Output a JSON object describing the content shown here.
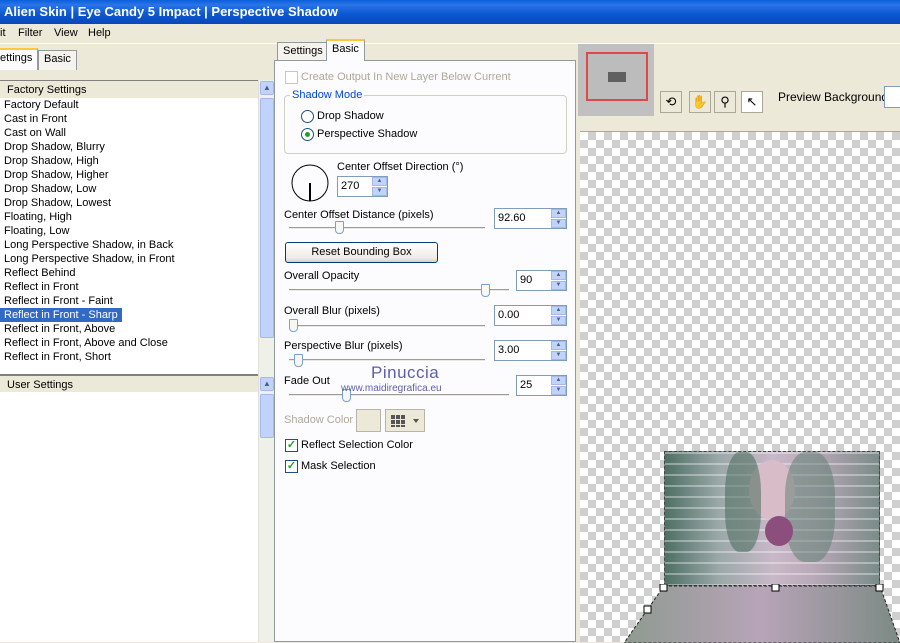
{
  "window": {
    "title": "Alien Skin  |  Eye Candy 5 Impact  |  Perspective Shadow"
  },
  "menu": {
    "items": [
      "it",
      "Filter",
      "View",
      "Help"
    ]
  },
  "left": {
    "tabs": [
      "ettings",
      "Basic"
    ],
    "factory_header": "Factory Settings",
    "presets": [
      "Factory Default",
      "Cast in Front",
      "Cast on Wall",
      "Drop Shadow, Blurry",
      "Drop Shadow, High",
      "Drop Shadow, Higher",
      "Drop Shadow, Low",
      "Drop Shadow, Lowest",
      "Floating, High",
      "Floating, Low",
      "Long Perspective Shadow, in Back",
      "Long Perspective Shadow, in Front",
      "Reflect Behind",
      "Reflect in Front",
      "Reflect in Front - Faint",
      "Reflect in Front - Sharp",
      "Reflect in Front, Above",
      "Reflect in Front, Above and Close",
      "Reflect in Front, Short"
    ],
    "selected_preset": "Reflect in Front - Sharp",
    "user_header": "User Settings"
  },
  "middle": {
    "tabs": [
      "Settings",
      "Basic"
    ],
    "create_output_label": "Create Output In New Layer Below Current",
    "shadow_mode": {
      "title": "Shadow Mode",
      "options": [
        "Drop Shadow",
        "Perspective Shadow"
      ],
      "selected": "Perspective Shadow"
    },
    "center_offset_direction": {
      "label": "Center Offset Direction (°)",
      "value": "270"
    },
    "center_offset_distance": {
      "label": "Center Offset Distance (pixels)",
      "value": "92.60",
      "position": 0.2
    },
    "reset_button": "Reset Bounding Box",
    "overall_opacity": {
      "label": "Overall Opacity",
      "value": "90",
      "position": 0.9
    },
    "overall_blur": {
      "label": "Overall Blur (pixels)",
      "value": "0.00",
      "position": 0.0
    },
    "perspective_blur": {
      "label": "Perspective Blur (pixels)",
      "value": "3.00",
      "position": 0.03
    },
    "fade_out": {
      "label": "Fade Out",
      "value": "25",
      "position": 0.25
    },
    "shadow_color_label": "Shadow Color",
    "shadow_color": "#ece9d8",
    "reflect_selection_color": {
      "label": "Reflect Selection Color",
      "checked": true
    },
    "mask_selection": {
      "label": "Mask Selection",
      "checked": true
    },
    "watermark": {
      "name": "Pinuccia",
      "url": "www.maidiregrafica.eu"
    }
  },
  "right": {
    "preview_background_label": "Preview Background:",
    "tools": [
      "navigate-icon",
      "hand-icon",
      "zoom-icon",
      "pointer-icon"
    ]
  }
}
